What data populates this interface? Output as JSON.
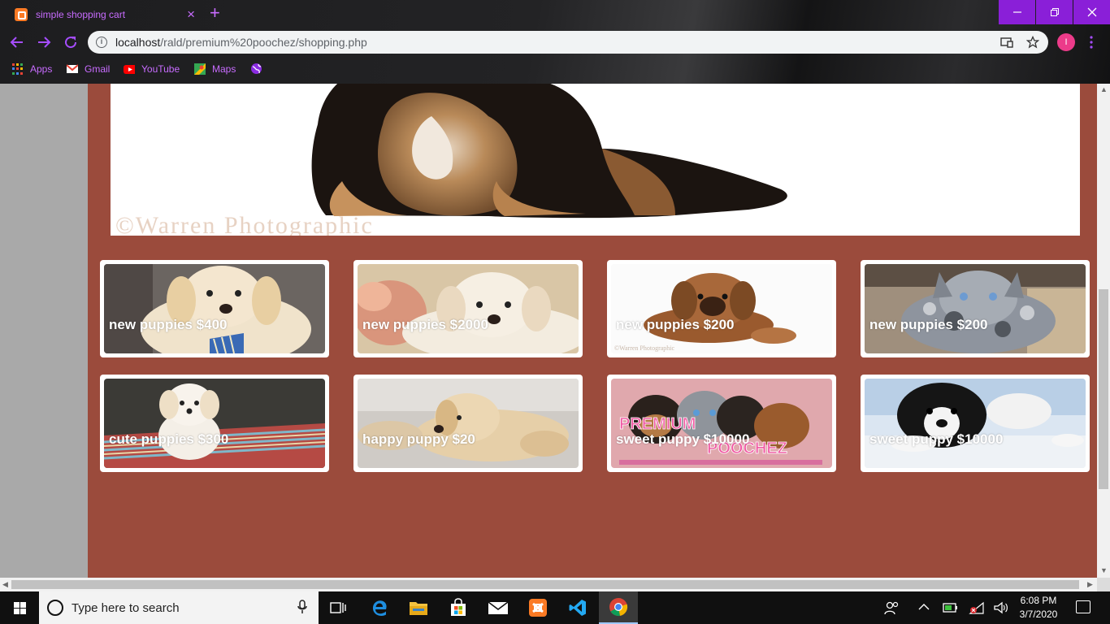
{
  "browser": {
    "tab_title": "simple shopping cart",
    "tab_close": "×",
    "new_tab": "+",
    "url_host": "localhost",
    "url_path": "/rald/premium%20poochez/shopping.php",
    "profile_initial": "I",
    "bookmarks": [
      {
        "label": "Apps",
        "icon": "apps-grid-icon"
      },
      {
        "label": "Gmail",
        "icon": "gmail-icon"
      },
      {
        "label": "YouTube",
        "icon": "youtube-icon"
      },
      {
        "label": "Maps",
        "icon": "maps-icon"
      }
    ],
    "accent_color": "#a64dff"
  },
  "page": {
    "background_color": "#9b4b3c",
    "hero_watermark": "©Warren Photographic",
    "products": [
      {
        "label": "new puppies  $400"
      },
      {
        "label": "new puppies  $2000"
      },
      {
        "label": "new puppies  $200"
      },
      {
        "label": "new puppies  $200"
      },
      {
        "label": "cute puppies  $300"
      },
      {
        "label": "happy puppy  $20"
      },
      {
        "label": "sweet puppy  $10000"
      },
      {
        "label": "sweet puppy  $10000"
      }
    ]
  },
  "taskbar": {
    "search_placeholder": "Type here to search",
    "time": "6:08 PM",
    "date": "3/7/2020"
  }
}
